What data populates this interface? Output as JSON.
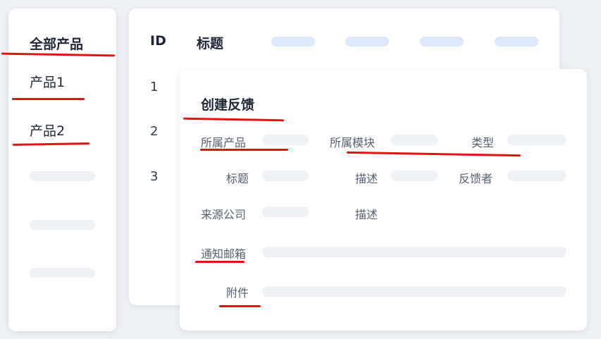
{
  "sidebar": {
    "items": [
      {
        "label": "全部产品"
      },
      {
        "label": "产品1"
      },
      {
        "label": "产品2"
      }
    ]
  },
  "table": {
    "headers": {
      "id": "ID",
      "title": "标题"
    },
    "rows": [
      {
        "id": "1"
      },
      {
        "id": "2"
      },
      {
        "id": "3"
      }
    ]
  },
  "modal": {
    "title": "创建反馈",
    "fields": {
      "product": "所属产品",
      "module": "所属模块",
      "type": "类型",
      "title": "标题",
      "description": "描述",
      "reporter": "反馈者",
      "source_company": "来源公司",
      "description2": "描述",
      "notify_email": "通知邮箱",
      "attachment": "附件"
    }
  },
  "colors": {
    "annotation": "#e01414",
    "placeholder": "#eef1f5",
    "header_placeholder": "#dbe8fb"
  }
}
